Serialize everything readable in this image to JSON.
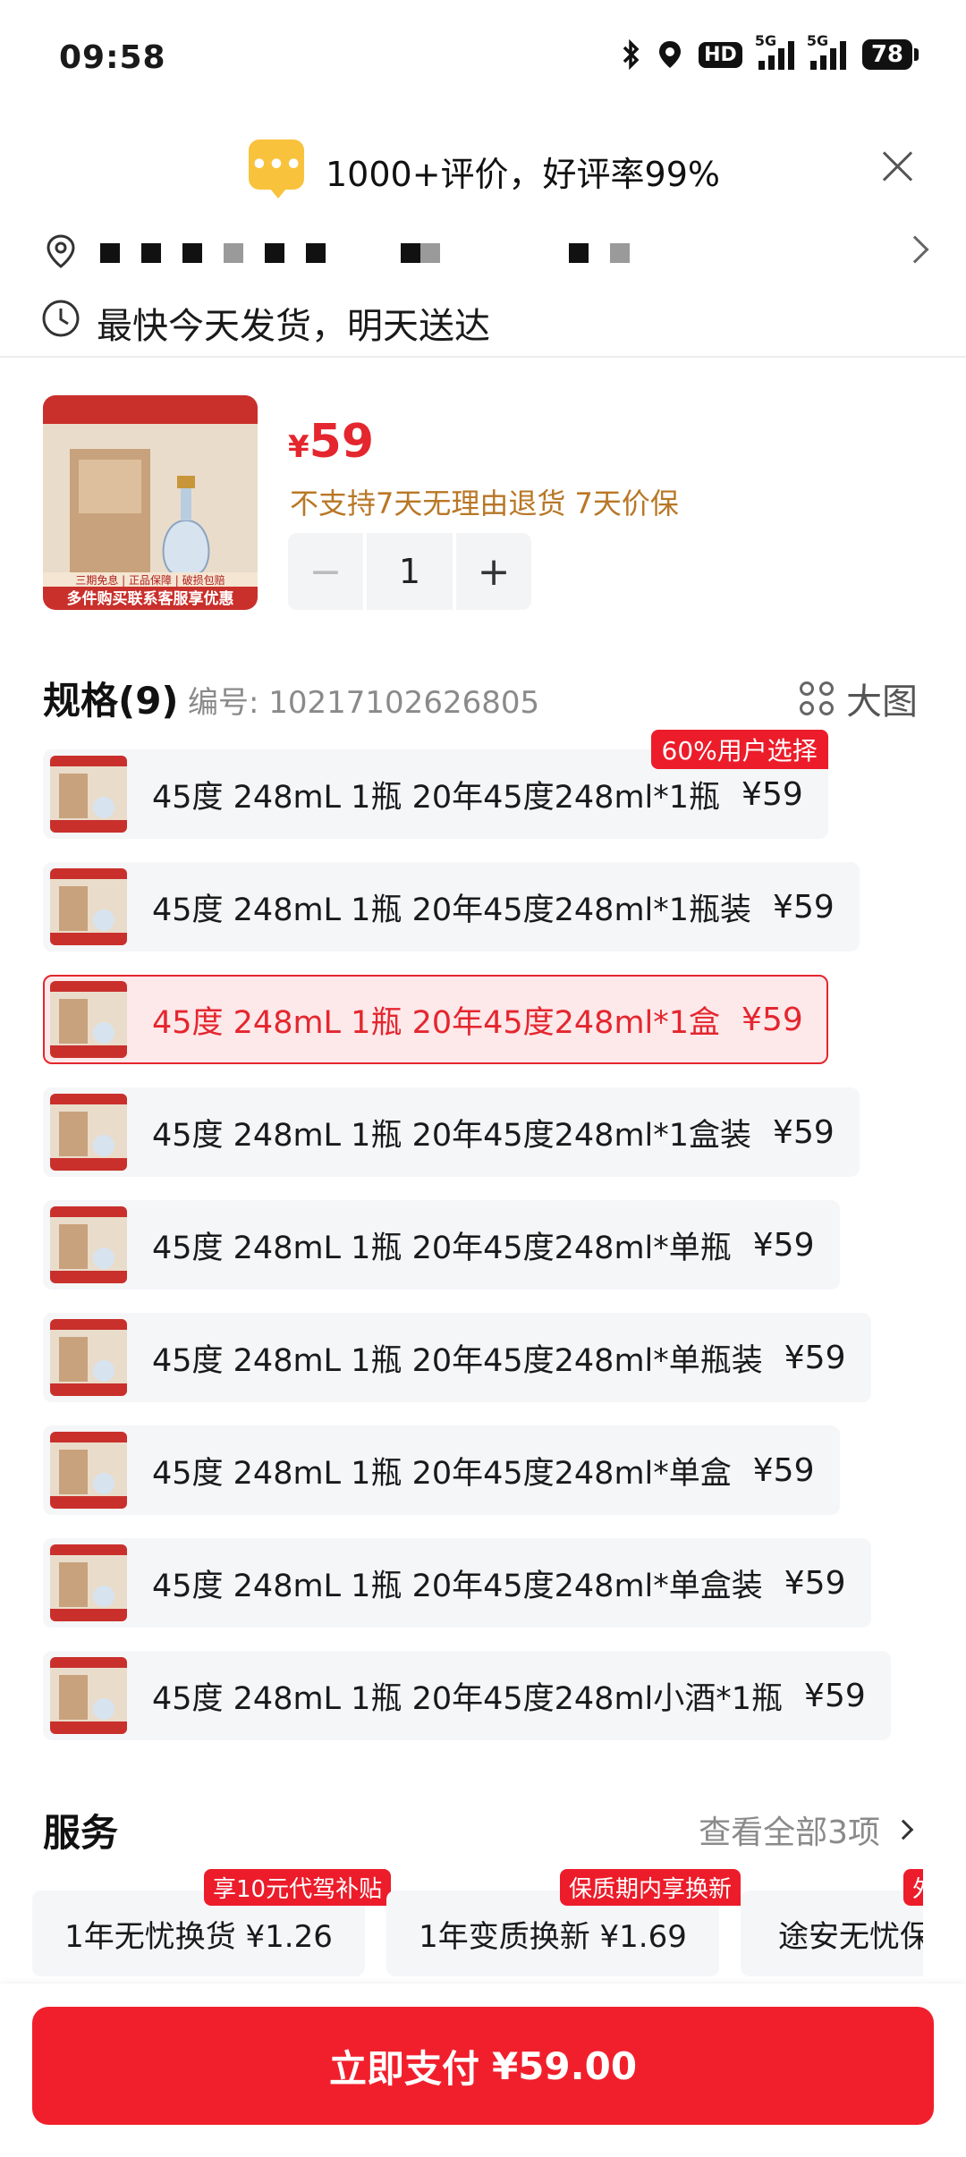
{
  "status_bar": {
    "time": "09:58",
    "icons": [
      "bluetooth-icon",
      "location-icon",
      "hd-icon",
      "5g-signal-icon",
      "5g-signal-icon",
      "battery-icon"
    ],
    "hd_label": "HD",
    "sim1_label": "5G",
    "sim2_label": "5G",
    "battery": "78"
  },
  "header": {
    "review_icon_text": "•••",
    "review_summary": "1000+评价，好评率99%"
  },
  "delivery": {
    "text": "最快今天发货，明天送达"
  },
  "product": {
    "thumb_banner": "多件购买联系客服享优惠",
    "thumb_tags": "三期免息 | 正品保障 | 破损包赔",
    "price_symbol": "¥",
    "price": "59",
    "note": "不支持7天无理由退货  7天价保",
    "quantity": "1",
    "minus": "−",
    "plus": "+"
  },
  "specs": {
    "title": "规格(9)",
    "code": "编号: 10217102626805",
    "big_image_label": "大图",
    "badge": "60%用户选择",
    "items": [
      {
        "label": "45度 248mL 1瓶  20年45度248ml*1瓶",
        "price": "¥59"
      },
      {
        "label": "45度 248mL 1瓶 20年45度248ml*1瓶装",
        "price": "¥59"
      },
      {
        "label": "45度 248mL 1瓶 20年45度248ml*1盒",
        "price": "¥59"
      },
      {
        "label": "45度 248mL 1瓶 20年45度248ml*1盒装",
        "price": "¥59"
      },
      {
        "label": "45度 248mL 1瓶 20年45度248ml*单瓶",
        "price": "¥59"
      },
      {
        "label": "45度 248mL 1瓶 20年45度248ml*单瓶装",
        "price": "¥59"
      },
      {
        "label": "45度 248mL 1瓶 20年45度248ml*单盒",
        "price": "¥59"
      },
      {
        "label": "45度 248mL 1瓶 20年45度248ml*单盒装",
        "price": "¥59"
      },
      {
        "label": "45度 248mL 1瓶 20年45度248ml小酒*1瓶",
        "price": "¥59"
      }
    ]
  },
  "services": {
    "title": "服务",
    "view_all": "查看全部3项",
    "cards": [
      {
        "tag": "享10元代驾补贴",
        "label": "1年无忧换货  ¥1.26"
      },
      {
        "tag": "保质期内享换新",
        "label": "1年变质换新  ¥1.69"
      },
      {
        "tag": "外",
        "label": "途安无忧保"
      }
    ]
  },
  "pay": {
    "label": "立即支付",
    "amount": "¥59.00"
  },
  "colors": {
    "accent_red": "#e4262e",
    "pay_button": "#f11f2c",
    "note_brown": "#b87726",
    "review_yellow": "#f8c23c"
  }
}
